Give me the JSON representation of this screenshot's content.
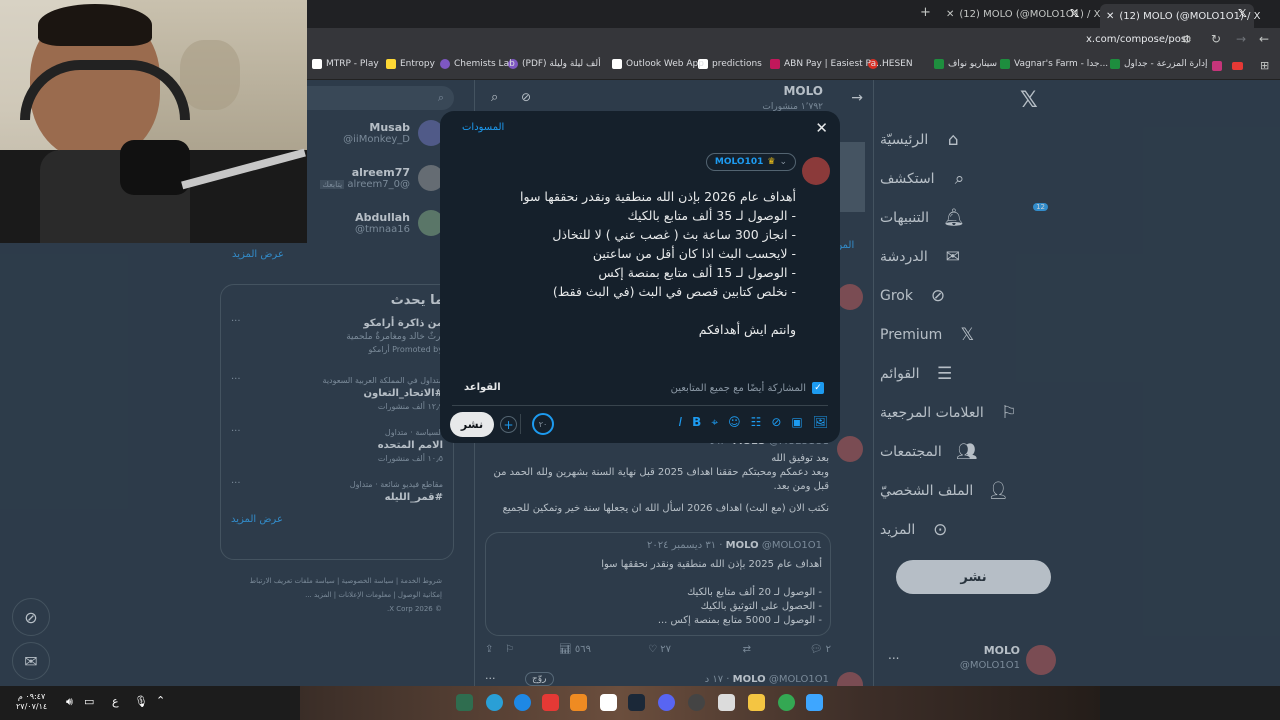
{
  "browser": {
    "tabs": [
      {
        "title": "(12) MOLO (@MOLO1O1) / X",
        "active": true
      },
      {
        "title": "(12) MOLO (@MOLO1O1) / X",
        "active": false
      }
    ],
    "url": "x.com/compose/post",
    "bookmarks": [
      "MTRP - Play",
      "Entropy",
      "Chemists Lab",
      "(PDF) ألف ليلة وليلة",
      "Outlook Web App",
      "predictions",
      "ABN Pay | Easiest Pa...",
      "HESEN",
      "سيناريو نواف",
      "Vagnar's Farm - جدا...",
      "إدارة المزرعة - جداول"
    ]
  },
  "sidebar": {
    "items": [
      {
        "label": "الرئيسيّة",
        "icon": "home-icon",
        "name": "home"
      },
      {
        "label": "استكشف",
        "icon": "search-icon",
        "name": "explore"
      },
      {
        "label": "التنبيهات",
        "icon": "bell-icon",
        "name": "notifications",
        "badge": "12"
      },
      {
        "label": "الدردشة",
        "icon": "mail-icon",
        "name": "chat"
      },
      {
        "label": "Grok",
        "icon": "grok-icon",
        "name": "grok"
      },
      {
        "label": "Premium",
        "icon": "x-logo-icon",
        "name": "premium"
      },
      {
        "label": "القوائم",
        "icon": "list-icon",
        "name": "lists"
      },
      {
        "label": "العلامات المرجعية",
        "icon": "bookmark-icon",
        "name": "bookmarks"
      },
      {
        "label": "المجتمعات",
        "icon": "people-icon",
        "name": "communities"
      },
      {
        "label": "الملف الشخصيّ",
        "icon": "person-icon",
        "name": "profile"
      },
      {
        "label": "المزيد",
        "icon": "more-circle-icon",
        "name": "more"
      }
    ],
    "post_button": "نشر",
    "account": {
      "name": "MOLO",
      "handle": "@MOLO1O1",
      "more": "..."
    }
  },
  "profile_header": {
    "name": "MOLO",
    "count": "١٬٧٩٢ منشورات"
  },
  "right": {
    "search_placeholder": "",
    "follow_suggestions": [
      {
        "name": "Musab",
        "handle": "@iiMonkey_D"
      },
      {
        "name": "alreem77",
        "handle": "@alreem7_0",
        "tag": "يتابعك"
      },
      {
        "name": "Abdullah",
        "handle": "@tmnaa16"
      }
    ],
    "show_more": "عرض المزيد",
    "trends_title": "ما يحدث",
    "trends": [
      {
        "title": "من ذاكرة أرامكو",
        "sub": "إرثٌ خالد ومغامرةٌ ملحمية",
        "meta": "Promoted by أرامكو"
      },
      {
        "context": "متداول في المملكة العربية السعودية",
        "title": "#الاتحاد_التعاون",
        "count": "١٢٫٩ ألف منشورات"
      },
      {
        "context": "السياسة · متداول",
        "title": "الامم المتحده",
        "count": "١٠٫٥ ألف منشورات"
      },
      {
        "context": "مقاطع فيديو شائعة · متداول",
        "title": "#قمر_الليله",
        "count": ""
      }
    ],
    "trends_more": "عرض المزيد",
    "footer": [
      "شروط الخدمة",
      "سياسة الخصوصية",
      "سياسة ملفات تعريف الارتباط",
      "إمكانية الوصول",
      "معلومات الإعلانات",
      "المزيد ...",
      "© 2026 X Corp."
    ]
  },
  "feed": {
    "post": {
      "name": "MOLO",
      "handle": "@MOLO1O1",
      "time": "٨ د",
      "lines": [
        "بعد توفيق الله",
        "وبعد دعمكم ومحبتكم حققنا اهداف 2025 قبل نهاية السنة بشهرين ولله الحمد من",
        "قبل ومن بعد.",
        "نكتب الان (مع البث) اهداف 2026 اسأل الله ان يجعلها سنة خير وتمكين للجميع"
      ],
      "quote": {
        "name": "MOLO",
        "handle": "@MOLO1O1",
        "date": "٣١ ديسمبر ٢٠٢٤",
        "lines": [
          "أهداف عام 2025 بإذن الله منطقية ونقدر نحققها سوا",
          "- الوصول لـ 20 ألف متابع بالكيك",
          "- الحصول على التوثيق بالكيك",
          "- الوصول لـ 5000 متابع بمنصة إكس ..."
        ]
      },
      "stats": {
        "replies": "٢",
        "likes": "٢٧",
        "views": "٥٦٩"
      }
    },
    "next_post": {
      "name": "MOLO",
      "handle": "@MOLO1O1",
      "time": "١٧ د",
      "label": "روّج"
    }
  },
  "compose": {
    "drafts": "المسودات",
    "account_chip": "MOLO101",
    "text_lines": [
      "أهداف عام 2026 بإذن الله منطقية ونقدر نحققها سوا",
      "- الوصول لـ 35 ألف متابع بالكيك",
      "- انجاز 300 ساعة بث ( غصب عني ) لا للتخاذل",
      "- لايحسب البث اذا كان أقل من ساعتين",
      "- الوصول لـ 15 ألف متابع بمنصة إكس",
      "- نخلص كتابين قصص في البث (في البث فقط)",
      "",
      "وانتم ايش أهدافكم"
    ],
    "share_label": "المشاركة أيضًا مع جميع المتابعين",
    "rules": "القواعد",
    "char_count": "٢٠",
    "post_button": "نشر"
  },
  "taskbar": {
    "lang": "ع",
    "time": "٠٩:٤٧ م",
    "date": "٢٧/٠٧/١٤"
  }
}
